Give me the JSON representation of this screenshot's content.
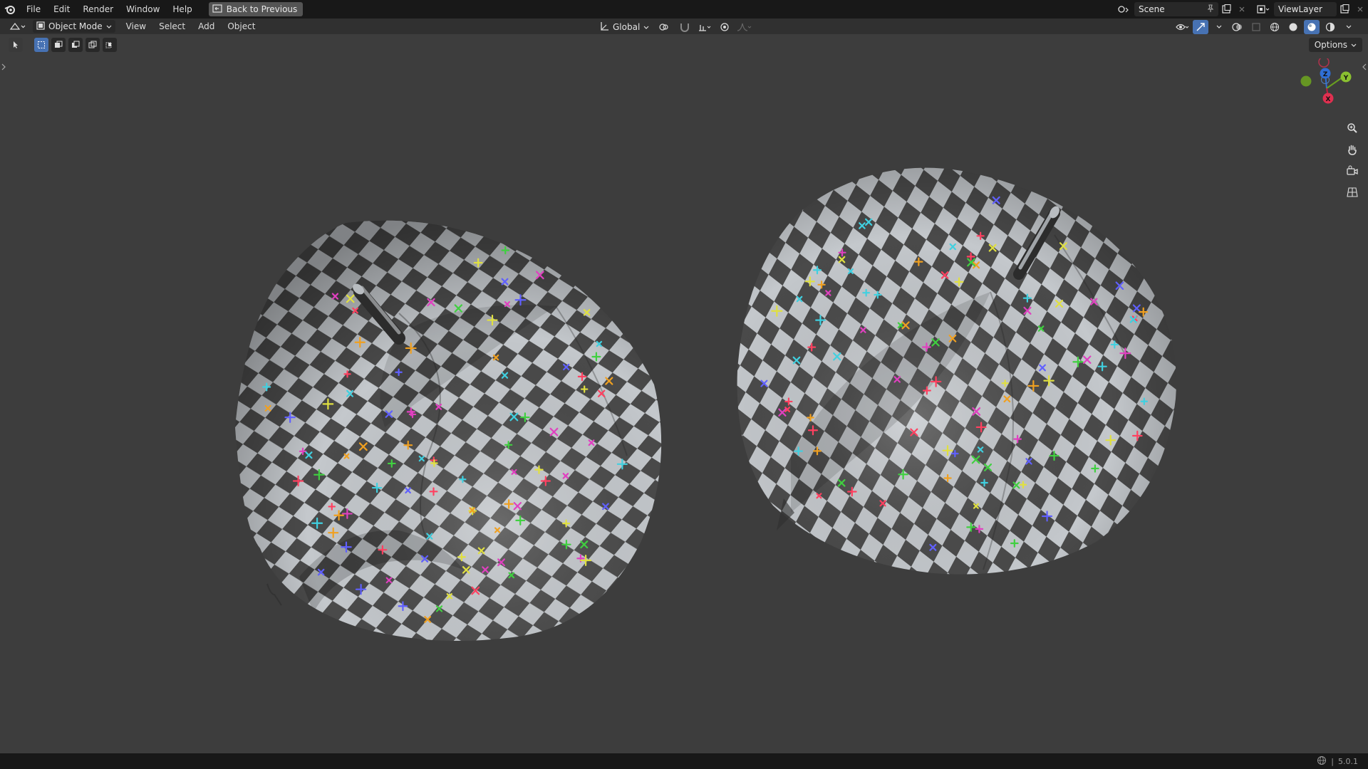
{
  "topbar": {
    "menu": [
      "File",
      "Edit",
      "Render",
      "Window",
      "Help"
    ],
    "back_button": "Back to Previous",
    "scene_name": "Scene",
    "view_layer": "ViewLayer"
  },
  "header": {
    "mode": "Object Mode",
    "menu": [
      "View",
      "Select",
      "Add",
      "Object"
    ],
    "transform_orientation": "Global"
  },
  "viewport": {
    "options_label": "Options",
    "gizmo_axes": {
      "z": "Z",
      "y": "Y",
      "x": "X"
    },
    "checker_colors": {
      "dark": "#4a4a4a",
      "light": "#c4c8cc",
      "markers": [
        "#e0e040",
        "#40d0e0",
        "#e040c0",
        "#40d040",
        "#6060ff",
        "#ff4060",
        "#f0a020"
      ]
    }
  },
  "status": {
    "version": "5.0.1"
  },
  "colors": {
    "topbar_bg": "#181818",
    "header_bg": "#303030",
    "viewport_bg": "#3d3d3d",
    "active_blue": "#4772b3"
  }
}
